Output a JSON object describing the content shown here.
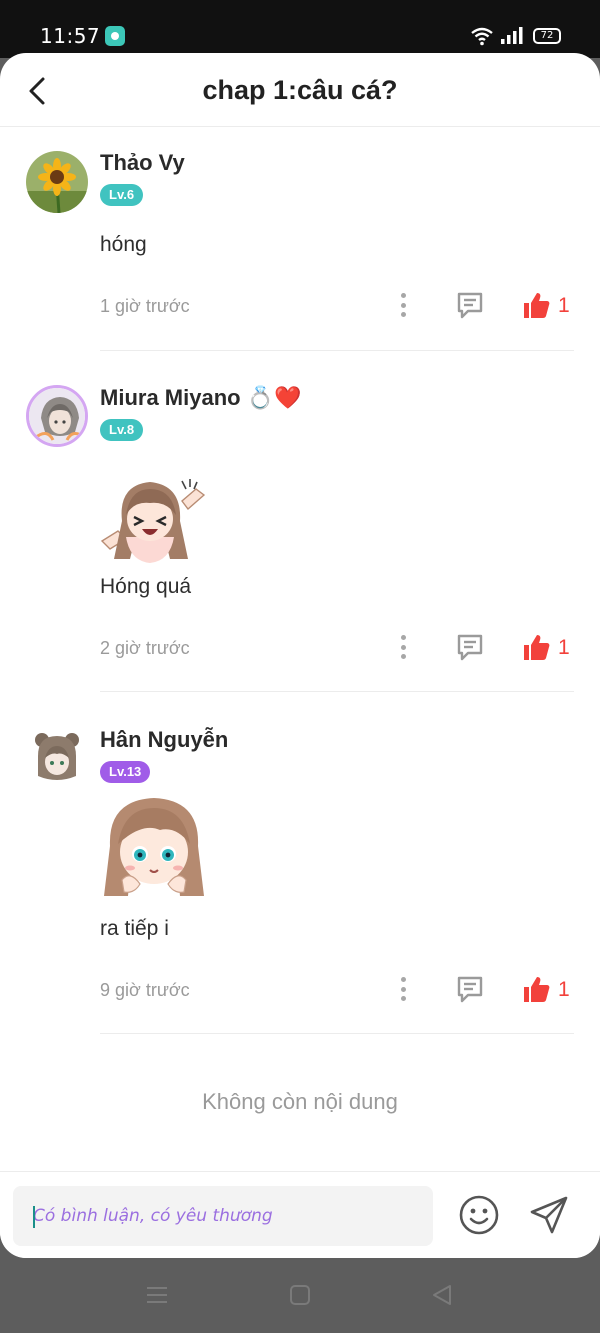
{
  "status_bar": {
    "time": "11:57",
    "battery": "72"
  },
  "header": {
    "title": "chap 1:câu cá?"
  },
  "comments": [
    {
      "name": "Thảo Vy",
      "level": "Lv.6",
      "level_color": "#40c3c0",
      "text": "hóng",
      "time": "1 giờ trước",
      "likes": "1",
      "avatar_icon": "sunflower-avatar"
    },
    {
      "name": "Miura Miyano",
      "name_suffix": "💍❤️",
      "level": "Lv.8",
      "level_color": "#40c3c0",
      "text": "Hóng quá",
      "time": "2 giờ trước",
      "likes": "1",
      "avatar_icon": "anime-avatar-framed",
      "sticker": "excited-girl-sticker"
    },
    {
      "name": "Hân Nguyễn",
      "level": "Lv.13",
      "level_color": "#a05ce8",
      "text": "ra tiếp i",
      "time": "9 giờ trước",
      "likes": "1",
      "avatar_icon": "anime-bear-avatar",
      "sticker": "girl-face-sticker"
    }
  ],
  "footer": {
    "end_text": "Không còn nội dung"
  },
  "input": {
    "placeholder": "Có bình luận, có yêu thương"
  },
  "colors": {
    "accent_like": "#f2413b",
    "level_teal": "#40c3c0",
    "level_purple": "#a05ce8"
  }
}
